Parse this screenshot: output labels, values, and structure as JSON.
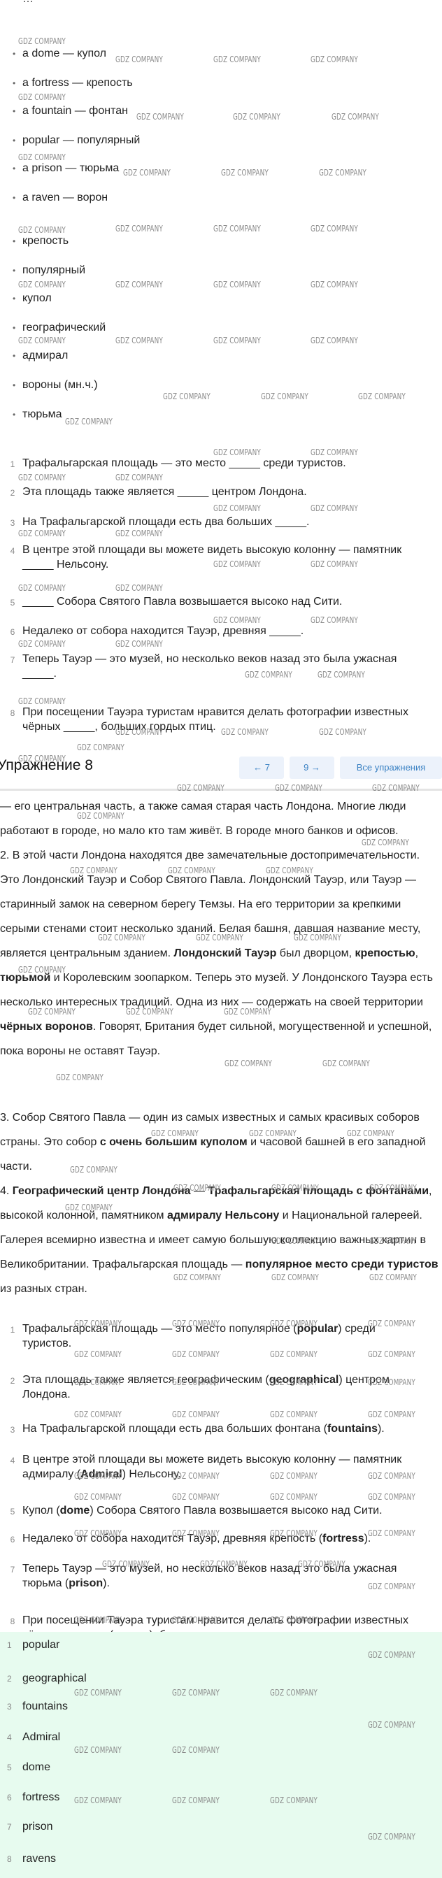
{
  "vocab_top_cut": "…",
  "vocab": [
    "a dome — купол",
    "a fortress — крепость",
    "a fountain — фонтан",
    "popular — популярный",
    "a prison — тюрьма",
    "a raven — ворон",
    "крепость",
    "популярный",
    "купол",
    "географический",
    "адмирал",
    "вороны (мн.ч.)",
    "тюрьма"
  ],
  "exercise7_items": [
    {
      "num": "1",
      "text": "Трафальгарская площадь — это место _____ среди туристов."
    },
    {
      "num": "2",
      "text": "Эта площадь также является _____ центром Лондона."
    },
    {
      "num": "3",
      "text": "На Трафальгарской площади есть два больших _____."
    },
    {
      "num": "4",
      "text": "В центре этой площади вы можете видеть высокую колонну — памятник _____ Нельсону."
    },
    {
      "num": "5",
      "text": "_____ Собора Святого Павла возвышается высоко над Сити."
    },
    {
      "num": "6",
      "text": "Недалеко от собора находится Тауэр, древняя _____."
    },
    {
      "num": "7",
      "text": "Теперь Тауэр — это музей, но несколько веков назад это была ужасная _____."
    },
    {
      "num": "8",
      "text": "При посещении Тауэра туристам нравится делать фотографии известных чёрных _____, больших гордых птиц."
    }
  ],
  "exercise8": {
    "title": "Упражнение 8",
    "prev_label": "← 7",
    "next_label": "9 →",
    "all_label": "Все упражнения"
  },
  "paragraphs": [
    "— его центральная часть, а также самая старая часть Лондона. Многие люди работают в городе, но мало кто там живёт. В городе много банков и офисов.",
    "2. В этой части Лондона находятся две замечательные достопримечательности. Это Лондонский Тауэр и Собор Святого Павла. Лондонский Тауэр, или Тауэр — старинный замок на северном берегу Темзы. На его территории за крепкими серыми стенами стоит несколько зданий. Белая башня, давшая название месту, является центральным зданием. <b>Лондонский Тауэр</b> был дворцом, <b>крепостью</b>, <b>тюрьмой</b> и Королевским зоопарком. Теперь это музей. У Лондонского Тауэра есть несколько интересных традиций. Одна из них — содержать на своей территории <b>чёрных воронов</b>. Говорят, Британия будет сильной, могущественной и успешной, пока вороны не оставят Тауэр.",
    "3. Собор Святого Павла — один из самых известных и самых красивых соборов страны. Это собор <b>с очень большим куполом</b> и часовой башней в его западной части.",
    "4. <b>Географический центр Лондона</b> — <b>Трафальгарская площадь с фонтанами</b>, высокой колонной, памятником <b>адмиралу Нельсону</b> и Национальной галереей. Галерея всемирно известна и имеет самую большую коллекцию важных картин в Великобритании. Трафальгарская площадь — <b>популярное место среди туристов</b> из разных стран."
  ],
  "exercise8_items": [
    {
      "num": "1",
      "text": "Трафальгарская площадь — это место популярное (<b>popular</b>) среди туристов."
    },
    {
      "num": "2",
      "text": "Эта площадь также является географическим (<b>geographical</b>) центром Лондона."
    },
    {
      "num": "3",
      "text": "На Трафальгарской площади есть два больших фонтана (<b>fountains</b>)."
    },
    {
      "num": "4",
      "text": "В центре этой площади вы можете видеть высокую колонну — памятник адмиралу (<b>Admiral</b>) Нельсону."
    },
    {
      "num": "5",
      "text": "Купол (<b>dome</b>) Собора Святого Павла возвышается высоко над Сити."
    },
    {
      "num": "6",
      "text": "Недалеко от собора находится Тауэр, древняя крепость (<b>fortress</b>)."
    },
    {
      "num": "7",
      "text": "Теперь Тауэр — это музей, но несколько веков назад это была ужасная тюрьма (<b>prison</b>)."
    },
    {
      "num": "8",
      "text": "При посещении Тауэра туристам нравится делать фотографии известных чёрных воронов (<b>ravens</b>), больших гордых птиц."
    }
  ],
  "answers": [
    {
      "num": "1",
      "text": "popular"
    },
    {
      "num": "2",
      "text": "geographical"
    },
    {
      "num": "3",
      "text": "fountains"
    },
    {
      "num": "4",
      "text": "Admiral"
    },
    {
      "num": "5",
      "text": "dome"
    },
    {
      "num": "6",
      "text": "fortress"
    },
    {
      "num": "7",
      "text": "prison"
    },
    {
      "num": "8",
      "text": "ravens"
    }
  ],
  "watermark_text": "GDZ COMPANY"
}
